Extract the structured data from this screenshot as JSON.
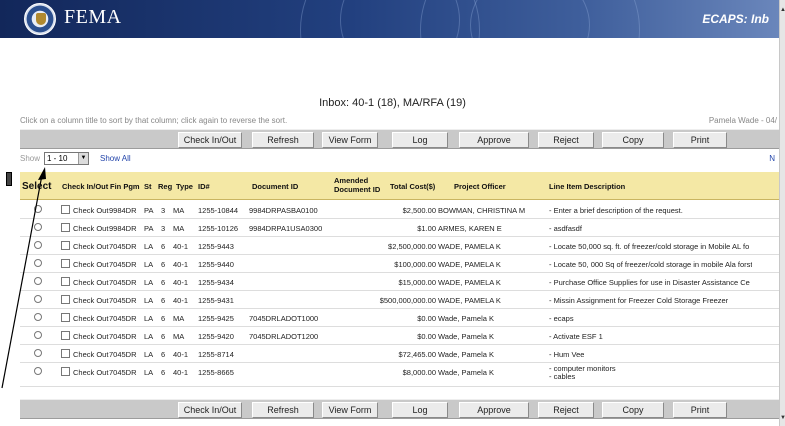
{
  "banner": {
    "brand": "FEMA",
    "app_title": "ECAPS: Inb",
    "seal": "dhs-seal-icon"
  },
  "inbox": {
    "title": "Inbox: 40-1 (18), MA/RFA (19)"
  },
  "hint": "Click on a column title to sort by that column; click again to reverse the sort.",
  "user": "Pamela Wade - 04/",
  "toolbar": {
    "buttons": [
      "Check In/Out",
      "Refresh",
      "View Form",
      "Log",
      "Approve",
      "Reject",
      "Copy",
      "Print"
    ]
  },
  "paging": {
    "show_label": "Show",
    "selected": "1 - 10",
    "show_all": "Show All",
    "next": "N"
  },
  "table": {
    "select_label": "Select",
    "headers": {
      "check": "Check In/Out",
      "fin": "Fin Pgm",
      "st": "St",
      "reg": "Reg",
      "type": "Type",
      "id": "ID#",
      "doc": "Document ID",
      "amended_1": "Amended",
      "amended_2": "Document ID",
      "cost": "Total Cost($)",
      "officer": "Project Officer",
      "desc": "Line Item Description"
    },
    "rows": [
      {
        "check": "Check Out",
        "fin": "9984DR",
        "st": "PA",
        "reg": "3",
        "type": "MA",
        "id": "1255-10844",
        "doc": "9984DRPASBA0100",
        "amended": "",
        "cost": "$2,500.00",
        "officer": "BOWMAN, CHRISTINA M",
        "desc": "- Enter a brief description of the request.",
        "desc2": ""
      },
      {
        "check": "Check Out",
        "fin": "9984DR",
        "st": "PA",
        "reg": "3",
        "type": "MA",
        "id": "1255-10126",
        "doc": "9984DRPA1USA0300",
        "amended": "",
        "cost": "$1.00",
        "officer": "ARMES, KAREN E",
        "desc": "- asdfasdf",
        "desc2": ""
      },
      {
        "check": "Check Out",
        "fin": "7045DR",
        "st": "LA",
        "reg": "6",
        "type": "40-1",
        "id": "1255-9443",
        "doc": "",
        "amended": "",
        "cost": "$2,500,000.00",
        "officer": "WADE, PAMELA K",
        "desc": "- Locate 50,000 sq. ft. of freezer/cold storage in Mobile AL fo",
        "desc2": ""
      },
      {
        "check": "Check Out",
        "fin": "7045DR",
        "st": "LA",
        "reg": "6",
        "type": "40-1",
        "id": "1255-9440",
        "doc": "",
        "amended": "",
        "cost": "$100,000.00",
        "officer": "WADE, PAMELA K",
        "desc": "- Locate 50, 000 Sq of freezer/cold storage in mobile Ala forst",
        "desc2": ""
      },
      {
        "check": "Check Out",
        "fin": "7045DR",
        "st": "LA",
        "reg": "6",
        "type": "40-1",
        "id": "1255-9434",
        "doc": "",
        "amended": "",
        "cost": "$15,000.00",
        "officer": "WADE, PAMELA K",
        "desc": "- Purchase Office Supplies for use in Disaster Assistance Ce",
        "desc2": ""
      },
      {
        "check": "Check Out",
        "fin": "7045DR",
        "st": "LA",
        "reg": "6",
        "type": "40-1",
        "id": "1255-9431",
        "doc": "",
        "amended": "",
        "cost": "$500,000,000.00",
        "officer": "WADE, PAMELA K",
        "desc": "- Missin Assignment for Freezer Cold Storage Freezer",
        "desc2": ""
      },
      {
        "check": "Check Out",
        "fin": "7045DR",
        "st": "LA",
        "reg": "6",
        "type": "MA",
        "id": "1255-9425",
        "doc": "7045DRLADOT1000",
        "amended": "",
        "cost": "$0.00",
        "officer": "Wade, Pamela K",
        "desc": "- ecaps",
        "desc2": ""
      },
      {
        "check": "Check Out",
        "fin": "7045DR",
        "st": "LA",
        "reg": "6",
        "type": "MA",
        "id": "1255-9420",
        "doc": "7045DRLADOT1200",
        "amended": "",
        "cost": "$0.00",
        "officer": "Wade, Pamela K",
        "desc": "- Activate ESF 1",
        "desc2": ""
      },
      {
        "check": "Check Out",
        "fin": "7045DR",
        "st": "LA",
        "reg": "6",
        "type": "40-1",
        "id": "1255-8714",
        "doc": "",
        "amended": "",
        "cost": "$72,465.00",
        "officer": "Wade, Pamela K",
        "desc": "- Hum Vee",
        "desc2": ""
      },
      {
        "check": "Check Out",
        "fin": "7045DR",
        "st": "LA",
        "reg": "6",
        "type": "40-1",
        "id": "1255-8665",
        "doc": "",
        "amended": "",
        "cost": "$8,000.00",
        "officer": "Wade, Pamela K",
        "desc": "- computer monitors",
        "desc2": "- cables"
      }
    ]
  }
}
